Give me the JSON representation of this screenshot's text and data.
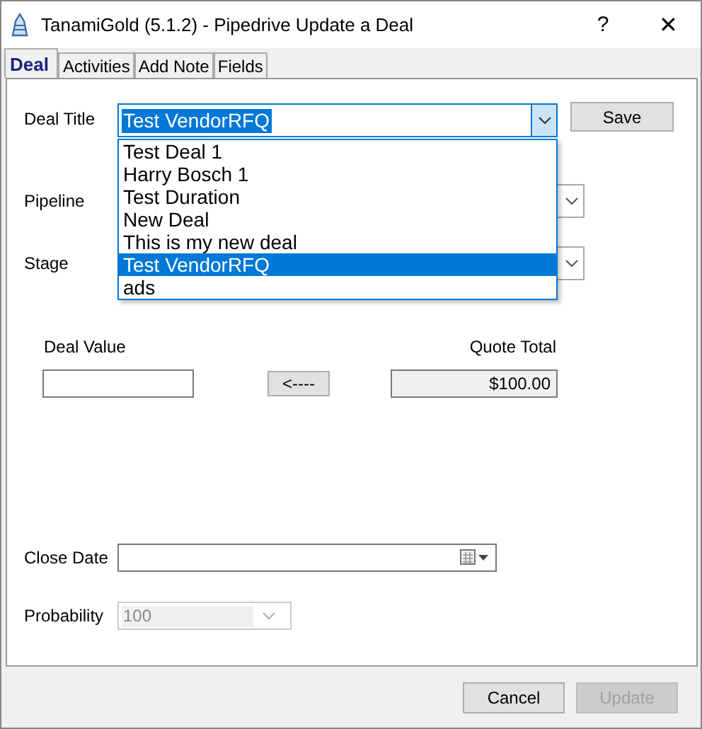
{
  "window": {
    "title": "TanamiGold (5.1.2) - Pipedrive Update a Deal",
    "help": "?",
    "close": "✕"
  },
  "tabs": [
    {
      "label": "Deal",
      "selected": true
    },
    {
      "label": "Activities",
      "selected": false
    },
    {
      "label": "Add Note",
      "selected": false
    },
    {
      "label": "Fields",
      "selected": false
    }
  ],
  "deal_title": {
    "label": "Deal Title",
    "value": "Test VendorRFQ",
    "expanded": true,
    "options": [
      {
        "label": "Test Deal 1",
        "selected": false
      },
      {
        "label": "Harry Bosch 1",
        "selected": false
      },
      {
        "label": "Test Duration",
        "selected": false
      },
      {
        "label": "New Deal",
        "selected": false
      },
      {
        "label": "This is my new deal",
        "selected": false
      },
      {
        "label": "Test VendorRFQ",
        "selected": true
      },
      {
        "label": "ads",
        "selected": false
      }
    ]
  },
  "save_button": "Save",
  "pipeline": {
    "label": "Pipeline"
  },
  "stage": {
    "label": "Stage"
  },
  "deal_value": {
    "label": "Deal Value"
  },
  "copy_button": "<----",
  "quote_total": {
    "label": "Quote Total",
    "value": "$100.00"
  },
  "close_date": {
    "label": "Close Date"
  },
  "probability": {
    "label": "Probability",
    "value": "100",
    "disabled": true
  },
  "buttons": [
    {
      "label": "Cancel",
      "disabled": false
    },
    {
      "label": "Update",
      "disabled": true
    }
  ]
}
